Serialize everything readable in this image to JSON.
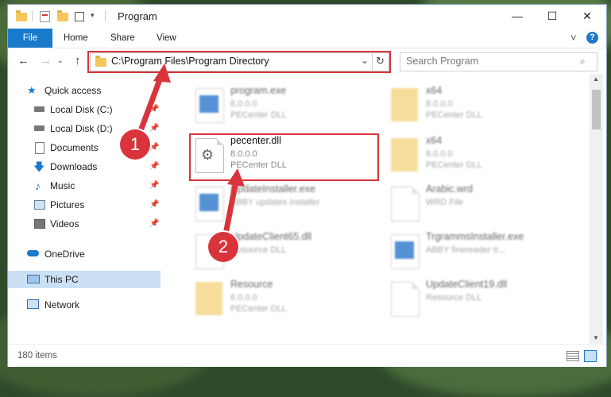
{
  "window": {
    "title": "Program",
    "minimize": "—",
    "maximize": "☐",
    "close": "✕"
  },
  "ribbon": {
    "tabs": [
      "File",
      "Home",
      "Share",
      "View"
    ],
    "collapse": "˅",
    "help": "?"
  },
  "address": {
    "path": "C:\\Program Files\\Program Directory",
    "search_placeholder": "Search Program"
  },
  "sidebar": {
    "items": [
      {
        "label": "Quick access",
        "icon": "star-icon",
        "pinned": false
      },
      {
        "label": "Local Disk (C:)",
        "icon": "drive-icon",
        "pinned": true
      },
      {
        "label": "Local Disk (D:)",
        "icon": "drive-icon",
        "pinned": true
      },
      {
        "label": "Documents",
        "icon": "documents-icon",
        "pinned": true
      },
      {
        "label": "Downloads",
        "icon": "download-arrow-icon",
        "pinned": true
      },
      {
        "label": "Music",
        "icon": "music-note-icon",
        "pinned": true
      },
      {
        "label": "Pictures",
        "icon": "pictures-icon",
        "pinned": true
      },
      {
        "label": "Videos",
        "icon": "film-icon",
        "pinned": true
      },
      {
        "label": "OneDrive",
        "icon": "cloud-icon",
        "pinned": false
      },
      {
        "label": "This PC",
        "icon": "monitor-icon",
        "pinned": false,
        "selected": true
      },
      {
        "label": "Network",
        "icon": "network-icon",
        "pinned": false
      }
    ]
  },
  "files": [
    {
      "name": "program.exe",
      "line2": "8.0.0.0",
      "line3": "PECenter DLL",
      "type": "exe",
      "blurred": true
    },
    {
      "name": "x64",
      "line2": "8.0.0.0",
      "line3": "PECenter DLL",
      "type": "folder",
      "blurred": true
    },
    {
      "name": "pecenter.dll",
      "line2": "8.0.0.0",
      "line3": "PECenter DLL",
      "type": "dll",
      "blurred": false
    },
    {
      "name": "x64",
      "line2": "8.0.0.0",
      "line3": "PECenter DLL",
      "type": "folder",
      "blurred": true
    },
    {
      "name": "UpdateInstaller.exe",
      "line2": "ABBY updates installer",
      "line3": "",
      "type": "exe",
      "blurred": true
    },
    {
      "name": "Arabic.wrd",
      "line2": "WRD File",
      "line3": "",
      "type": "doc",
      "blurred": true
    },
    {
      "name": "UpdateClient65.dll",
      "line2": "Resource DLL",
      "line3": "",
      "type": "dll",
      "blurred": true
    },
    {
      "name": "TrgrammsInstaller.exe",
      "line2": "ABBY finereader tr...",
      "line3": "",
      "type": "exe",
      "blurred": true
    },
    {
      "name": "Resource",
      "line2": "8.0.0.0",
      "line3": "PECenter DLL",
      "type": "folder",
      "blurred": true
    },
    {
      "name": "UpdateClient19.dll",
      "line2": "Resource DLL",
      "line3": "",
      "type": "dll",
      "blurred": true
    }
  ],
  "status": {
    "count": "180 items"
  },
  "annotations": {
    "badge1": "1",
    "badge2": "2"
  },
  "colors": {
    "accent": "#1979ca",
    "highlight": "#d9343b"
  }
}
